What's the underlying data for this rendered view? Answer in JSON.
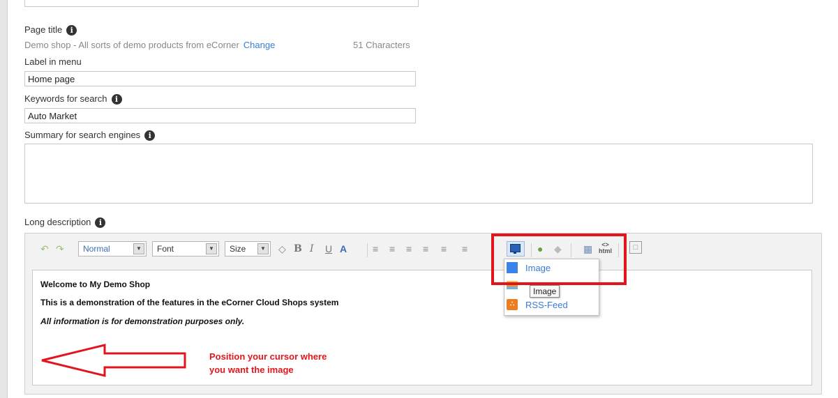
{
  "page_title": {
    "label": "Page title",
    "value": "Demo shop - All sorts of demo products from eCorner",
    "change_link": "Change",
    "char_count": "51 Characters"
  },
  "label_in_menu": {
    "label": "Label in menu",
    "value": "Home page"
  },
  "keywords": {
    "label": "Keywords for search",
    "value": "Auto Market"
  },
  "summary": {
    "label": "Summary for search engines",
    "value": ""
  },
  "long_description": {
    "label": "Long description",
    "toolbar": {
      "format": "Normal",
      "font": "Font",
      "size": "Size",
      "bold": "B",
      "italic": "I",
      "underline": "U",
      "html": "html"
    },
    "content": {
      "line1": "Welcome to My Demo Shop",
      "line2": "This is a demonstration of the features in the eCorner Cloud Shops system",
      "line3": "All information is for demonstration purposes only."
    },
    "insert_menu": {
      "items": [
        "Image",
        "",
        "RSS-Feed"
      ],
      "tooltip": "Image"
    }
  },
  "annotation": {
    "line1": "Position your cursor where",
    "line2": "you want the image"
  },
  "colors": {
    "accent": "#e3151c",
    "link": "#3a7bd5",
    "info_icon": "#333333"
  }
}
